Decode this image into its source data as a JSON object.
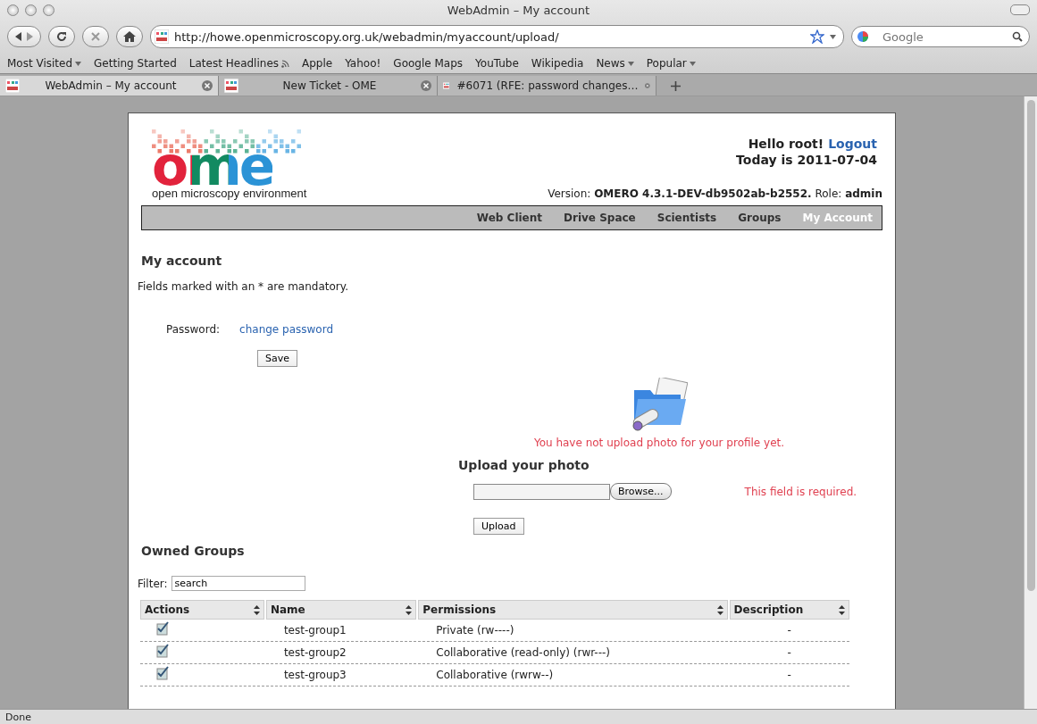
{
  "window": {
    "title": "WebAdmin – My account"
  },
  "toolbar": {
    "url": "http://howe.openmicroscopy.org.uk/webadmin/myaccount/upload/",
    "search": {
      "placeholder": "Google"
    }
  },
  "bookmarks": [
    {
      "label": "Most Visited",
      "kind": "menu"
    },
    {
      "label": "Getting Started",
      "kind": "link"
    },
    {
      "label": "Latest Headlines",
      "kind": "feed"
    },
    {
      "label": "Apple",
      "kind": "link"
    },
    {
      "label": "Yahoo!",
      "kind": "link"
    },
    {
      "label": "Google Maps",
      "kind": "link"
    },
    {
      "label": "YouTube",
      "kind": "link"
    },
    {
      "label": "Wikipedia",
      "kind": "link"
    },
    {
      "label": "News",
      "kind": "menu"
    },
    {
      "label": "Popular",
      "kind": "menu"
    }
  ],
  "tabs": [
    {
      "label": "WebAdmin – My account",
      "selected": true
    },
    {
      "label": "New Ticket - OME",
      "selected": false
    },
    {
      "label": "#6071 (RFE: password changes…",
      "selected": false
    }
  ],
  "page": {
    "logo": {
      "letters": "ome",
      "tagline": "open microscopy environment"
    },
    "greeting": "Hello root!",
    "logout": "Logout",
    "date": "Today is 2011-07-04",
    "version": "Version: **OMERO 4.3.1-DEV-db9502ab-b2552.** Role: **admin**",
    "nav": [
      {
        "label": "Web Client",
        "selected": false
      },
      {
        "label": "Drive Space",
        "selected": false
      },
      {
        "label": "Scientists",
        "selected": false
      },
      {
        "label": "Groups",
        "selected": false
      },
      {
        "label": "My Account",
        "selected": true
      }
    ],
    "heading": "My account",
    "note": "Fields marked with an * are mandatory.",
    "password": {
      "label": "Password:",
      "link": "change password"
    },
    "save": "Save",
    "photo": {
      "message": "You have not upload photo for your profile yet.",
      "heading": "Upload your photo",
      "browse": "Browse...",
      "error": "This field is required.",
      "upload": "Upload"
    },
    "groups": {
      "heading": "Owned Groups",
      "filter_label": "Filter:",
      "filter_value": "search",
      "columns": [
        "Actions",
        "Name",
        "Permissions",
        "Description"
      ],
      "rows": [
        {
          "name": "test-group1",
          "permissions": "Private (rw----)",
          "description": "-"
        },
        {
          "name": "test-group2",
          "permissions": "Collaborative (read-only) (rwr---)",
          "description": "-"
        },
        {
          "name": "test-group3",
          "permissions": "Collaborative (rwrw--)",
          "description": "-"
        }
      ]
    }
  },
  "status_bar": "Done"
}
